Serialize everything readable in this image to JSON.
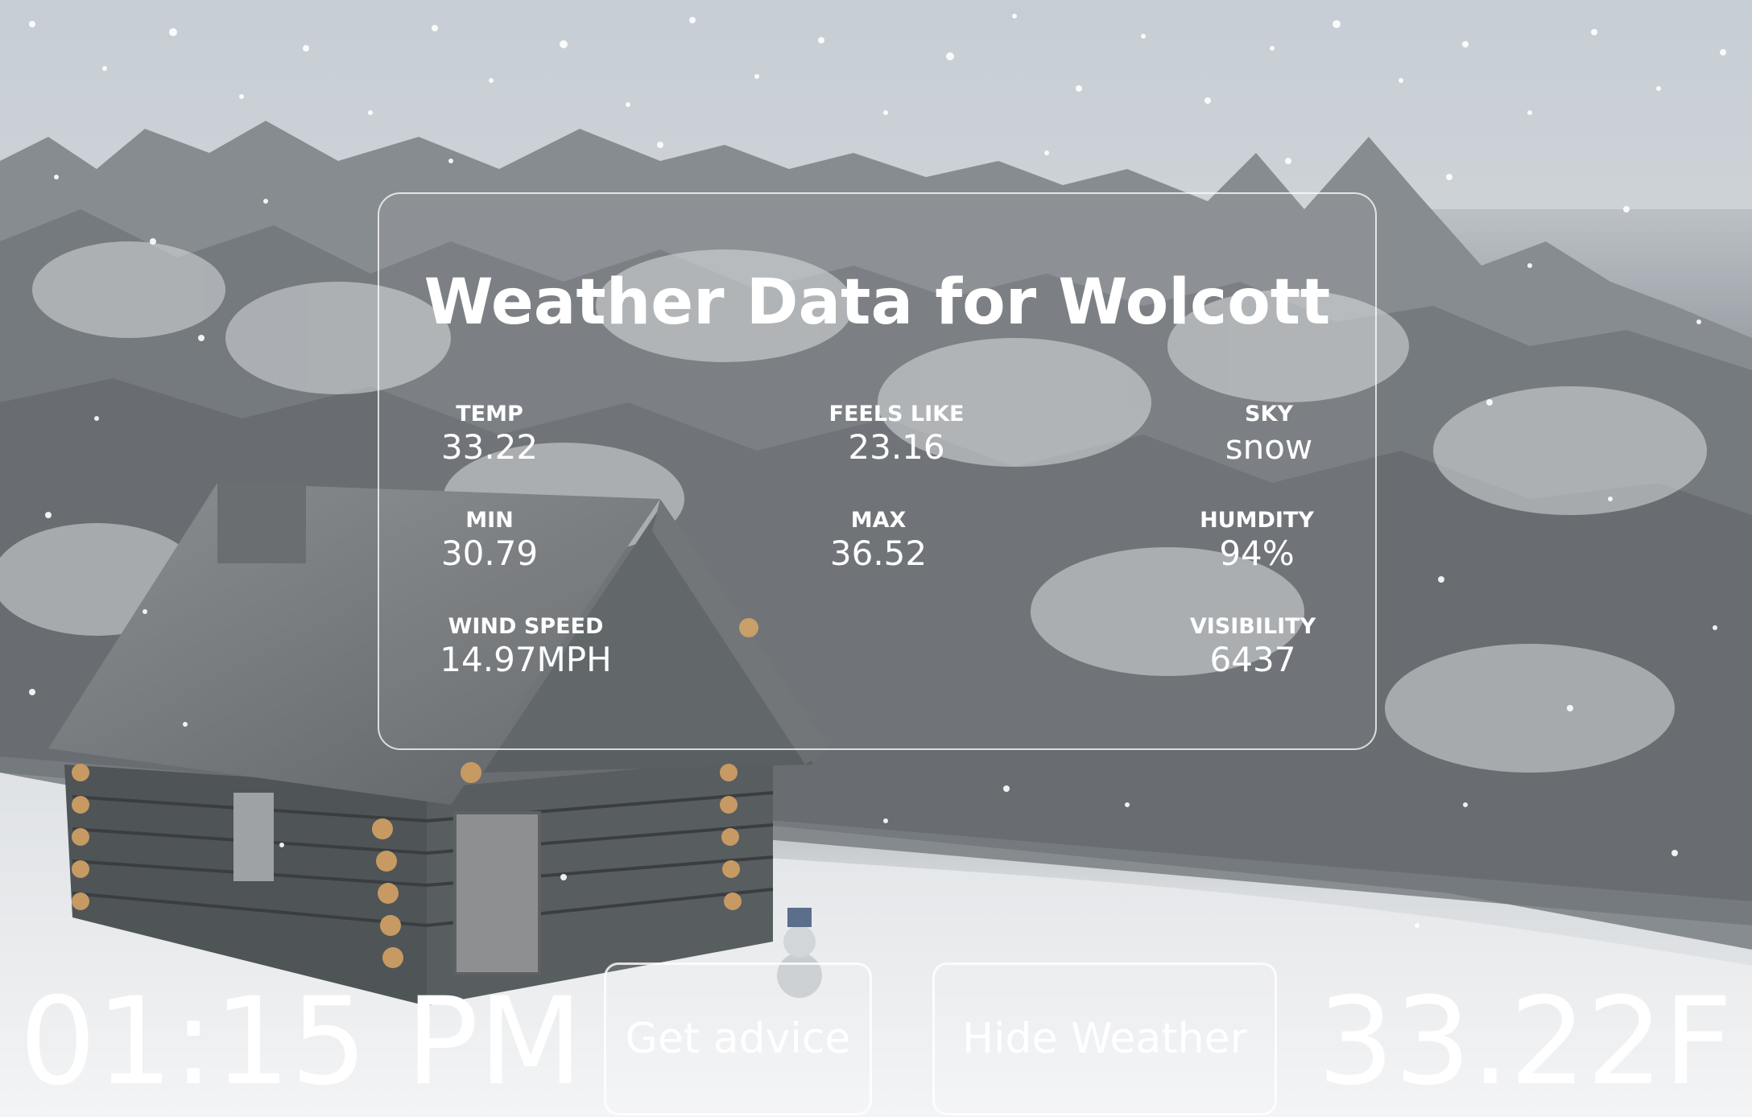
{
  "panel": {
    "title": "Weather Data for Wolcott",
    "stats": {
      "temp": {
        "label": "TEMP",
        "value": "33.22"
      },
      "feels_like": {
        "label": "FEELS LIKE",
        "value": "23.16"
      },
      "sky": {
        "label": "SKY",
        "value": "snow"
      },
      "min": {
        "label": "MIN",
        "value": "30.79"
      },
      "max": {
        "label": "MAX",
        "value": "36.52"
      },
      "humidity": {
        "label": "HUMDITY",
        "value": "94%"
      },
      "wind_speed": {
        "label": "WIND SPEED",
        "value": "14.97MPH"
      },
      "visibility": {
        "label": "VISIBILITY",
        "value": "6437"
      }
    }
  },
  "footer": {
    "time": "01:15 PM",
    "current_temp": "33.22F",
    "advice_button": "Get advice",
    "hide_button": "Hide Weather"
  },
  "background": {
    "scene": "snowy-forest-with-log-cabin",
    "colors": {
      "sky": "#c3cbd2",
      "trees": "#7e8387",
      "snow_ground": "#eef0f1",
      "cabin_wood": "#4f5457",
      "log_ends": "#c79a63"
    }
  }
}
